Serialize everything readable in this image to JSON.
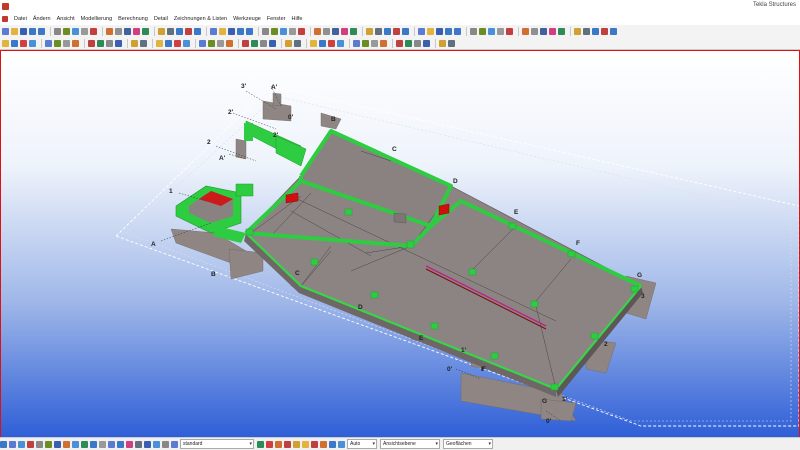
{
  "window": {
    "title": "Tekla Structures"
  },
  "menu": {
    "items": [
      "Datei",
      "Ändern",
      "Ansicht",
      "Modellierung",
      "Berechnung",
      "Detail",
      "Zeichnungen & Listen",
      "Werkzeuge",
      "Fenster",
      "Hilfe"
    ]
  },
  "toolbar1": {
    "buttons": [
      {
        "icon": "new-icon",
        "color": "#5a7bd1"
      },
      {
        "icon": "open-icon",
        "color": "#e2b43c"
      },
      {
        "icon": "save-icon",
        "color": "#3a5fb0"
      },
      {
        "icon": "undo-icon",
        "color": "#3c78c8"
      },
      {
        "icon": "redo-icon",
        "color": "#3c78c8"
      },
      {
        "icon": "select-icon",
        "color": "#888888"
      },
      {
        "icon": "properties-icon",
        "color": "#6b8e23"
      },
      {
        "icon": "view-icon",
        "color": "#4a90d9"
      },
      {
        "icon": "grid-icon",
        "color": "#999999"
      },
      {
        "icon": "beam-icon",
        "color": "#c04040"
      },
      {
        "icon": "column-icon",
        "color": "#d07030"
      },
      {
        "icon": "plate-icon",
        "color": "#909090"
      },
      {
        "icon": "bolt-icon",
        "color": "#4060a0"
      },
      {
        "icon": "weld-icon",
        "color": "#d04080"
      },
      {
        "icon": "component-icon",
        "color": "#2e8b57"
      },
      {
        "icon": "drawing-icon",
        "color": "#d0a030"
      },
      {
        "icon": "report-icon",
        "color": "#607080"
      },
      {
        "icon": "numbering-icon",
        "color": "#3c78c8"
      },
      {
        "icon": "clash-icon",
        "color": "#c04040"
      },
      {
        "icon": "help-icon",
        "color": "#3c78c8"
      }
    ]
  },
  "toolbar2": {
    "buttons": [
      {
        "icon": "snap-icon",
        "color": "#e2b43c"
      },
      {
        "icon": "line-icon",
        "color": "#3c78c8"
      },
      {
        "icon": "point-icon",
        "color": "#d04040"
      },
      {
        "icon": "measure-icon",
        "color": "#4a90d9"
      },
      {
        "icon": "copy-icon",
        "color": "#5a7bd1"
      },
      {
        "icon": "move-icon",
        "color": "#6b8e23"
      },
      {
        "icon": "mirror-icon",
        "color": "#999999"
      },
      {
        "icon": "rotate-icon",
        "color": "#d07030"
      },
      {
        "icon": "cut-icon",
        "color": "#c04040"
      },
      {
        "icon": "fit-icon",
        "color": "#2e8b57"
      },
      {
        "icon": "clip-icon",
        "color": "#888888"
      },
      {
        "icon": "render-icon",
        "color": "#3a5fb0"
      },
      {
        "icon": "filter-icon",
        "color": "#d0a030"
      },
      {
        "icon": "layer-icon",
        "color": "#607080"
      }
    ]
  },
  "statusbar": {
    "filter_value": "standard",
    "zoom_value": "Auto",
    "view_type_value": "Ansichtsebene",
    "surface_value": "Geoflächen"
  },
  "grid_labels": {
    "letters": [
      "A",
      "B",
      "C",
      "D",
      "E",
      "F",
      "G"
    ],
    "numbers": [
      "1",
      "2",
      "3",
      "0'",
      "1'",
      "2'"
    ],
    "upper_letters": [
      "A'",
      "B",
      "C",
      "D",
      "E",
      "F",
      "G",
      "B'",
      "0'"
    ],
    "misc": [
      "3'",
      "A'",
      "2'",
      "1'",
      "G",
      "0'"
    ]
  },
  "colors": {
    "accent_green": "#2ecc40",
    "concrete": "#8f8683",
    "viewport_border": "#dd1111",
    "alert_red": "#d01010"
  }
}
